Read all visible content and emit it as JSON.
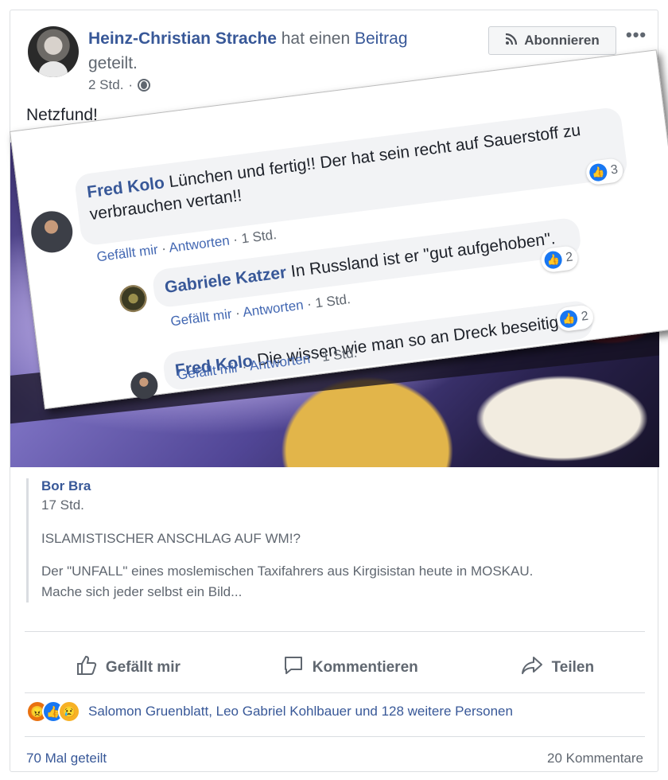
{
  "post": {
    "author": "Heinz-Christian Strache",
    "action_text": "hat einen",
    "action_link": "Beitrag",
    "action_suffix": "geteilt.",
    "time": "2 Std.",
    "privacy_icon": "globe-icon",
    "subscribe_label": "Abonnieren",
    "subscribe_icon": "rss-icon",
    "more_label": "•••",
    "text": "Netzfund!"
  },
  "overlay_comments": [
    {
      "name": "Fred Kolo",
      "text_line1": "Lünchen und fertig!! Der hat sein recht auf Sauerstoff zu",
      "text_line2": "verbrauchen vertan!!",
      "like_label": "Gefällt mir",
      "reply_label": "Antworten",
      "time": "1 Std.",
      "reactions": "3"
    },
    {
      "name": "Gabriele Katzer",
      "text": "In Russland ist er \"gut aufgehoben\".",
      "like_label": "Gefällt mir",
      "reply_label": "Antworten",
      "time": "1 Std.",
      "reactions": "2"
    },
    {
      "name": "Fred Kolo",
      "text": "Die wissen wie man so an Dreck beseitigt",
      "like_label": "Gefällt mir",
      "reply_label": "Antworten",
      "time": "1 Std.",
      "reactions": "2"
    }
  ],
  "shared": {
    "name": "Bor Bra",
    "time": "17 Std.",
    "headline": "ISLAMISTISCHER ANSCHLAG AUF WM!?",
    "body_line1": "Der \"UNFALL\" eines moslemischen Taxifahrers aus Kirgisistan heute in MOSKAU.",
    "body_line2": "Mache sich jeder selbst ein Bild..."
  },
  "actions": {
    "like": "Gefällt mir",
    "comment": "Kommentieren",
    "share": "Teilen"
  },
  "reactions_summary": "Salomon Gruenblatt, Leo Gabriel Kohlbauer und 128 weitere Personen",
  "shares": "70 Mal geteilt",
  "comments_count": "20 Kommentare",
  "colors": {
    "link": "#385898",
    "secondary_text": "#606770",
    "like_blue": "#1877f2"
  }
}
